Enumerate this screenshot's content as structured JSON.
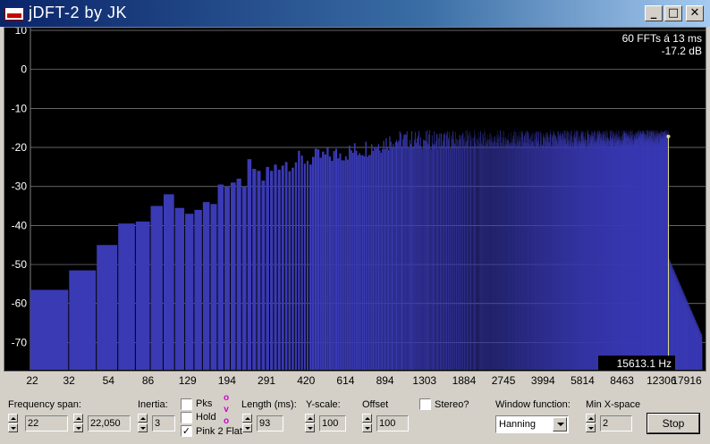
{
  "window": {
    "title": "jDFT-2 by JK",
    "minimize": "_",
    "maximize": "□",
    "close": "✕"
  },
  "plot": {
    "info_line1": "60 FFTs á 13 ms",
    "info_line2": "-17.2 dB",
    "cursor_freq": "15613.1 Hz",
    "y_ticks": [
      "10",
      "0",
      "-10",
      "-20",
      "-30",
      "-40",
      "-50",
      "-60",
      "-70"
    ],
    "x_ticks": [
      "22",
      "32",
      "54",
      "86",
      "129",
      "194",
      "291",
      "420",
      "614",
      "894",
      "1303",
      "1884",
      "2745",
      "3994",
      "5814",
      "8463",
      "12306",
      "17916"
    ],
    "colors": {
      "bars": "#3a3ab4",
      "background": "#000000",
      "grid": "#c0c0c0",
      "cursor": "#e0e080"
    }
  },
  "chart_data": {
    "type": "bar",
    "ylim": [
      -77,
      10
    ],
    "x_ticks": [
      "22",
      "32",
      "54",
      "86",
      "129",
      "194",
      "291",
      "420",
      "614",
      "894",
      "1303",
      "1884",
      "2745",
      "3994",
      "5814",
      "8463",
      "12306",
      "17916"
    ],
    "y_ticks": [
      10,
      0,
      -10,
      -20,
      -30,
      -40,
      -50,
      -60,
      -70
    ],
    "first_bars_db": [
      -56.5,
      -51.5,
      -45,
      -39.5,
      -39,
      -35,
      -32,
      -35.5,
      -37,
      -36,
      -34,
      -34.5,
      -29.5,
      -30,
      -29,
      -28,
      -30,
      -23,
      -25.5,
      -26,
      -28.5,
      -25,
      -26
    ],
    "cursor": {
      "freq_hz": 15613.1,
      "level_db": -17.2
    }
  },
  "controls": {
    "freq_span_label": "Frequency span:",
    "freq_min": "22",
    "freq_max": "22,050",
    "inertia_label": "Inertia:",
    "inertia_value": "3",
    "pks_label": "Pks",
    "hold_label": "Hold",
    "pink_label": "Pink 2 Flat",
    "pink_checked": "✓",
    "ovo": [
      "o",
      "v",
      "o"
    ],
    "length_label": "Length (ms):",
    "length_value": "93",
    "yscale_label": "Y-scale:",
    "yscale_value": "100",
    "offset_label": "Offset",
    "offset_value": "100",
    "stereo_label": "Stereo?",
    "window_fn_label": "Window function:",
    "window_fn_value": "Hanning",
    "minx_label": "Min X-space",
    "minx_value": "2",
    "stop_label": "Stop"
  }
}
